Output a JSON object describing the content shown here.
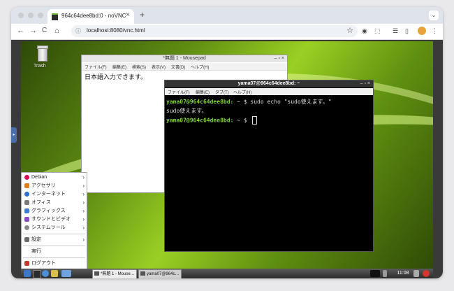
{
  "browser": {
    "tab_title": "964c64dee8bd:0 - noVNC",
    "tab_close": "×",
    "new_tab": "+",
    "tab_menu": "⌄",
    "url": "localhost:8080/vnc.html",
    "nav_back": "←",
    "nav_forward": "→",
    "nav_reload": "C",
    "nav_home": "⌂",
    "site_info": "ⓘ",
    "bookmark": "☆",
    "ext_icons": [
      "◉",
      "⬚",
      "☰",
      "▯",
      "✿",
      "⋮"
    ]
  },
  "novnc": {
    "control_handle": "▸"
  },
  "desktop": {
    "trash_label": "Trash"
  },
  "mousepad": {
    "title": "*無題 1 - Mousepad",
    "controls": "–  ▫  ×",
    "menu": [
      "ファイル(F)",
      "編集(E)",
      "検索(S)",
      "表示(V)",
      "文書(D)",
      "ヘルプ(H)"
    ],
    "content": "日本語入力できます。"
  },
  "terminal": {
    "title": "yama07@964c64dee8bd: ~",
    "controls": "–  ▫  ×",
    "menu": [
      "ファイル(F)",
      "編集(E)",
      "タブ(T)",
      "ヘルプ(H)"
    ],
    "prompt": "yama07@964c64dee8bd:",
    "prompt_tail": " ~ $ ",
    "command": "sudo echo \"sudo使えます。\"",
    "output": "sudo使えます。"
  },
  "start_menu": {
    "items": [
      {
        "label": "Debian",
        "arrow": "›",
        "color": "#d70a53"
      },
      {
        "label": "アクセサリ",
        "arrow": "›",
        "color": "#e07b1a"
      },
      {
        "label": "インターネット",
        "arrow": "›",
        "color": "#2a6fc9"
      },
      {
        "label": "オフィス",
        "arrow": "›",
        "color": "#7a7a7a"
      },
      {
        "label": "グラフィックス",
        "arrow": "›",
        "color": "#3a7bd5"
      },
      {
        "label": "サウンドとビデオ",
        "arrow": "›",
        "color": "#8a4bc4"
      },
      {
        "label": "システムツール",
        "arrow": "›",
        "color": "#888888"
      },
      {
        "label": "設定",
        "arrow": "›",
        "color": "#6a6a6a"
      },
      {
        "label": "実行",
        "arrow": "",
        "color": "#ffffff"
      },
      {
        "label": "ログアウト",
        "arrow": "",
        "color": "#c0392b"
      }
    ]
  },
  "taskbar": {
    "windows": [
      "*無題 1 - Mouse…",
      "yama07@964c…"
    ],
    "clock": "11:08"
  }
}
